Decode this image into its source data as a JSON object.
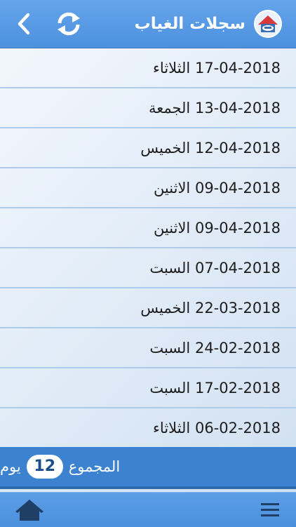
{
  "header": {
    "title": "سجلات الغياب",
    "back_icon": "chevron-left-icon",
    "refresh_icon": "refresh-icon",
    "logo_icon": "school-logo-icon"
  },
  "records": [
    {
      "date": "17-04-2018",
      "day": "الثلاثاء"
    },
    {
      "date": "13-04-2018",
      "day": "الجمعة"
    },
    {
      "date": "12-04-2018",
      "day": "الخميس"
    },
    {
      "date": "09-04-2018",
      "day": "الاثنين"
    },
    {
      "date": "09-04-2018",
      "day": "الاثنين"
    },
    {
      "date": "07-04-2018",
      "day": "السبت"
    },
    {
      "date": "22-03-2018",
      "day": "الخميس"
    },
    {
      "date": "24-02-2018",
      "day": "السبت"
    },
    {
      "date": "17-02-2018",
      "day": "السبت"
    },
    {
      "date": "06-02-2018",
      "day": "الثلاثاء"
    }
  ],
  "total": {
    "label": "المجموع",
    "count": "12",
    "unit": "يوم"
  },
  "bottom_bar": {
    "home_icon": "home-icon",
    "menu_icon": "menu-icon"
  },
  "colors": {
    "header": "#4d90de",
    "total_bar": "#3c82d0",
    "row_divider": "#aecbe9"
  }
}
